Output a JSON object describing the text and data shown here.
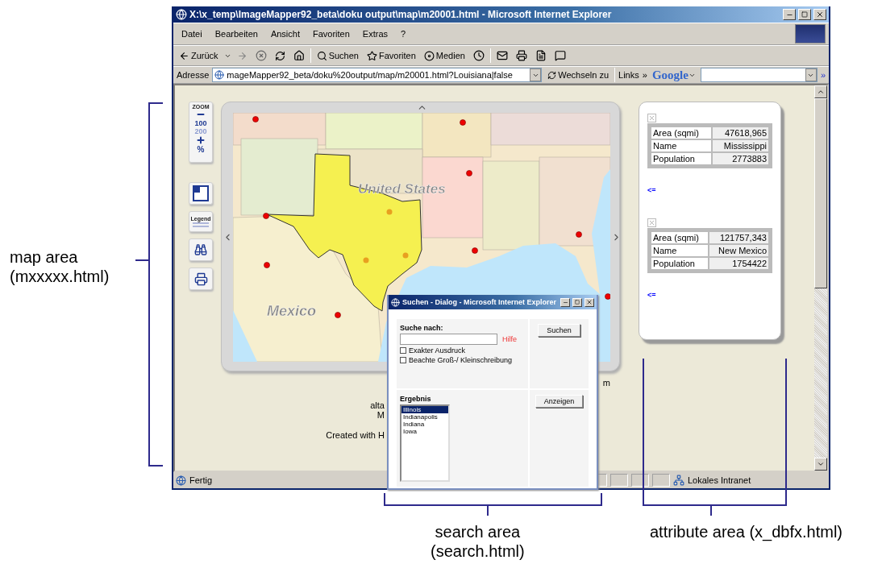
{
  "window": {
    "title": "X:\\x_temp\\ImageMapper92_beta\\doku output\\map\\m20001.html - Microsoft Internet Explorer"
  },
  "menu": [
    "Datei",
    "Bearbeiten",
    "Ansicht",
    "Favoriten",
    "Extras",
    "?"
  ],
  "toolbar": {
    "back": "Zurück",
    "search": "Suchen",
    "favorites": "Favoriten",
    "media": "Medien"
  },
  "address": {
    "label": "Adresse",
    "value": "mageMapper92_beta/doku%20output/map/m20001.html?Louisiana|false",
    "go": "Wechseln zu",
    "links": "Links",
    "links_more": "»",
    "google": "Google",
    "more": "»"
  },
  "tools": {
    "zoom_title": "ZOOM",
    "zoom_levels": [
      {
        "label": "100",
        "selected": true
      },
      {
        "label": "200",
        "selected": false
      }
    ],
    "percent": "%",
    "legend": "Legend"
  },
  "map": {
    "labels": [
      {
        "kind": "country",
        "text": "United States"
      },
      {
        "kind": "country",
        "text": "Mexico"
      }
    ]
  },
  "below_map": {
    "right_fragment": "m",
    "lines": [
      "alta",
      "M",
      "Created with H"
    ]
  },
  "attributes": [
    {
      "rows": [
        {
          "label": "Area (sqmi)",
          "value": "47618,965"
        },
        {
          "label": "Name",
          "value": "Mississippi"
        },
        {
          "label": "Population",
          "value": "2773883"
        }
      ],
      "back_link": "<="
    },
    {
      "rows": [
        {
          "label": "Area (sqmi)",
          "value": "121757,343"
        },
        {
          "label": "Name",
          "value": "New Mexico"
        },
        {
          "label": "Population",
          "value": "1754422"
        }
      ],
      "back_link": "<="
    }
  ],
  "status_bar": {
    "text": "Fertig",
    "zone": "Lokales Intranet"
  },
  "dialog": {
    "title": "Suchen - Dialog - Microsoft Internet Explorer",
    "search_label": "Suche nach:",
    "help": "Hilfe",
    "options": [
      {
        "label": "Exakter Ausdruck",
        "checked": false
      },
      {
        "label": "Beachte Groß-/ Kleinschreibung",
        "checked": false
      }
    ],
    "search_button": "Suchen",
    "result_label": "Ergebnis",
    "results": [
      {
        "label": "Illinois",
        "selected": true
      },
      {
        "label": "Indianapolis",
        "selected": false
      },
      {
        "label": "Indiana",
        "selected": false
      },
      {
        "label": "Iowa",
        "selected": false
      }
    ],
    "show_button": "Anzeigen"
  },
  "annotations": [
    {
      "kind": "left",
      "lines": [
        "map area",
        "(mxxxxx.html)"
      ]
    },
    {
      "kind": "search",
      "lines": [
        "search area",
        "(search.html)"
      ]
    },
    {
      "kind": "attribute",
      "lines": [
        "attribute area (x_dbfx.html)"
      ]
    }
  ]
}
